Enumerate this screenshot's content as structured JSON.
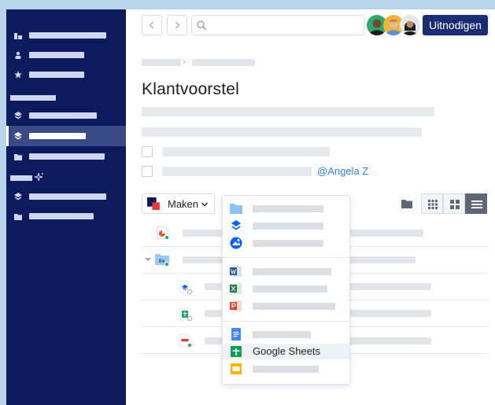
{
  "header": {
    "back_icon": "chevron-left-icon",
    "forward_icon": "chevron-right-icon",
    "search_placeholder": "",
    "invite_label": "Uitnodigen"
  },
  "page": {
    "title": "Klantvoorstel",
    "mention": "@Angela Z"
  },
  "toolbar": {
    "create_label": "Maken"
  },
  "dropdown": {
    "highlighted_label": "Google Sheets"
  },
  "colors": {
    "sidebar": "#0d1b5c",
    "accent": "#1a2d72",
    "mention": "#3580d6",
    "sync_ok": "#1fa84f",
    "background": "#b8d3ea"
  }
}
